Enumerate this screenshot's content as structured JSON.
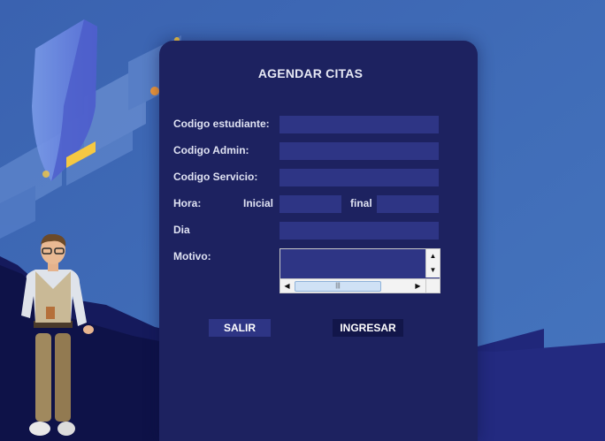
{
  "form": {
    "title": "AGENDAR CITAS",
    "labels": {
      "codigo_estudiante": "Codigo estudiante:",
      "codigo_admin": "Codigo Admin:",
      "codigo_servicio": "Codigo Servicio:",
      "hora": "Hora:",
      "inicial": "Inicial",
      "final": "final",
      "dia": "Dia",
      "motivo": "Motivo:"
    },
    "values": {
      "codigo_estudiante": "",
      "codigo_admin": "",
      "codigo_servicio": "",
      "hora_inicial": "",
      "hora_final": "",
      "dia": "",
      "motivo": ""
    },
    "buttons": {
      "salir": "SALIR",
      "ingresar": "INGRESAR"
    }
  },
  "colors": {
    "background": "#3f6db4",
    "panel": "#1d2260",
    "field": "#2e3585",
    "salir_button": "#2e3585",
    "ingresar_button": "#12164a"
  },
  "icons": [
    "shield-illustration",
    "person-illustration",
    "scroll-up-arrow",
    "scroll-down-arrow",
    "scroll-left-arrow",
    "scroll-right-arrow"
  ]
}
